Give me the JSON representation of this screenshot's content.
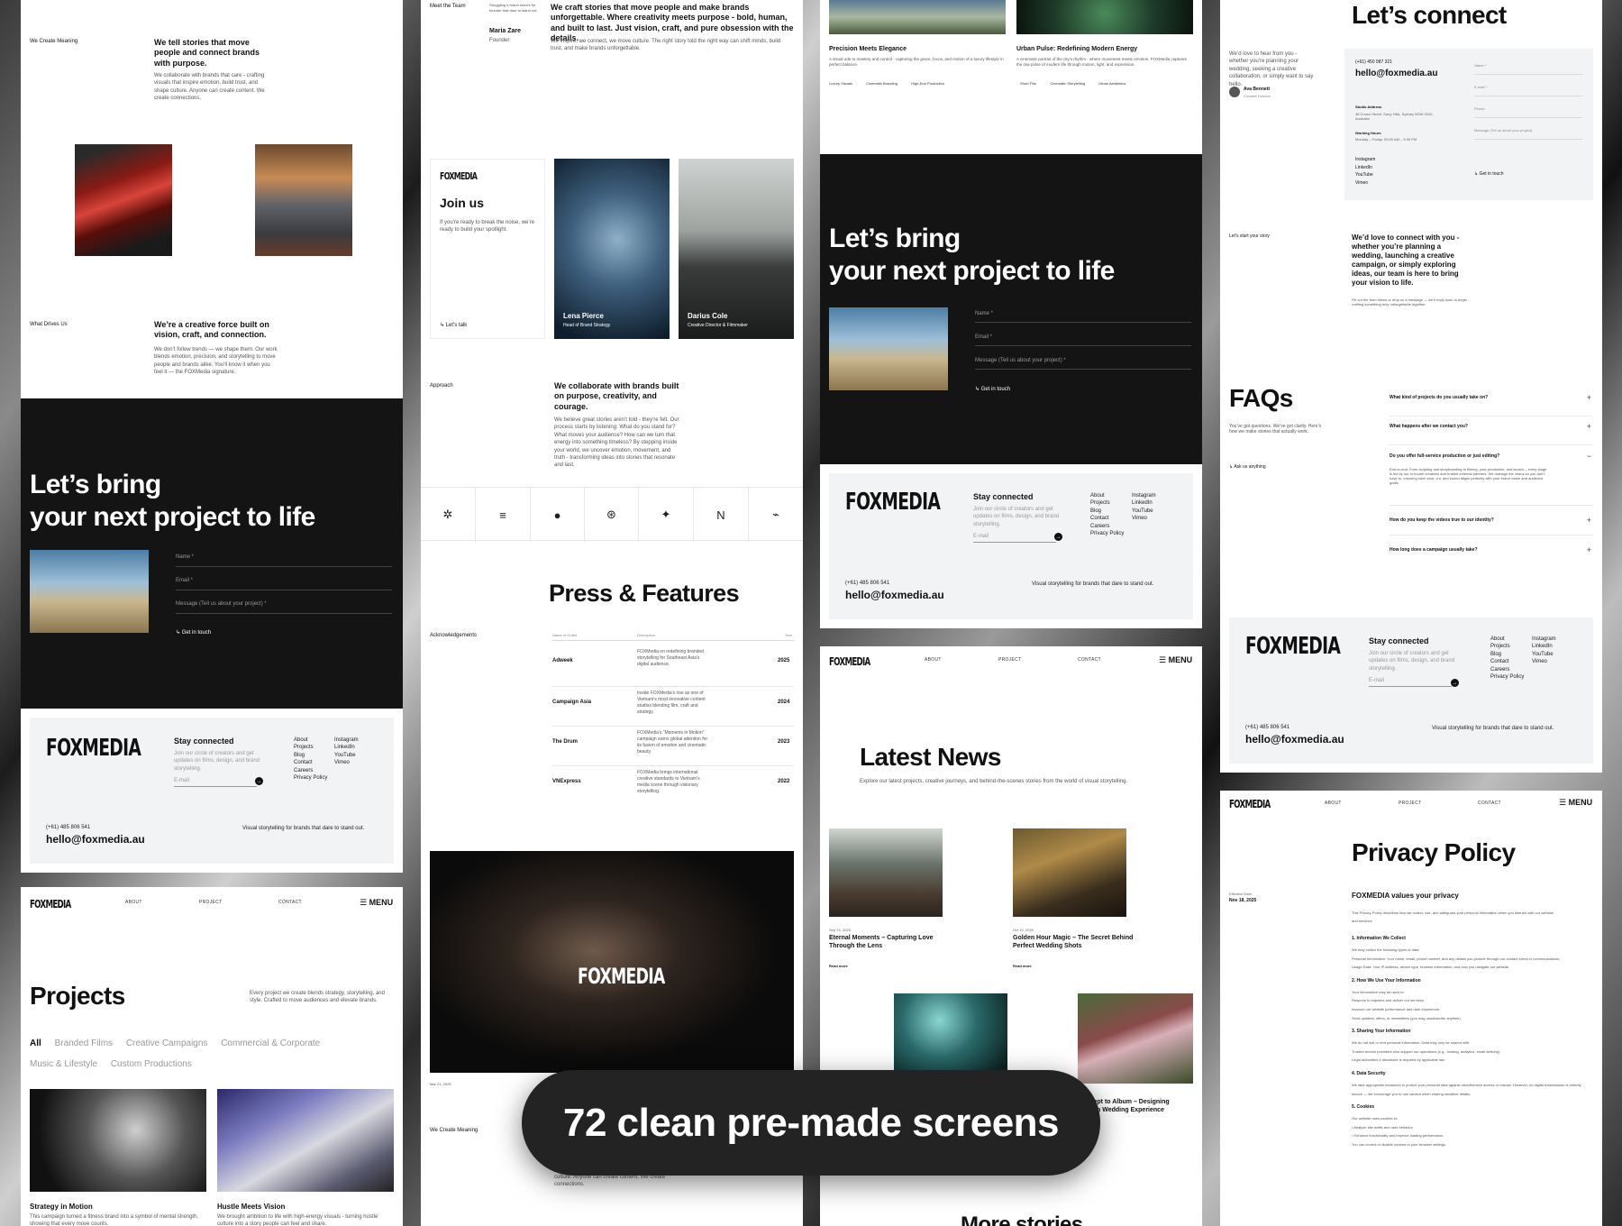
{
  "banner": {
    "text": "72 clean pre-made screens"
  },
  "brand": {
    "logo": "FOXMEDIA",
    "email": "hello@foxmedia.au",
    "phone": "(+61) 485 806 541",
    "phone2": "(+61) 450 987 321",
    "tagline": "Visual storytelling for brands that dare to stand out.",
    "stay": "Stay connected",
    "stay_desc": "Join our circle of creators and get updates on films, design, and brand storytelling.",
    "email_ph": "E-mail",
    "footer_links": [
      "About",
      "Projects",
      "Blog",
      "Contact",
      "Careers",
      "Privacy Policy"
    ],
    "social": [
      "Instagram",
      "LinkedIn",
      "YouTube",
      "Vimeo"
    ]
  },
  "cta": {
    "title1": "Let’s bring",
    "title2": "your next project to life",
    "name": "Name *",
    "email": "Email *",
    "message": "Message (Tell us about your project) *",
    "button": "Get in touch"
  },
  "col1": {
    "create_label": "We Create Meaning",
    "create_title": "We tell stories that move people and connect brands with purpose.",
    "create_body": "We collaborate with brands that care - crafting visuals that inspire emotion, build trust, and shape culture. Anyone can create content. We create connections.",
    "drives_label": "What Drives Us",
    "drives_title": "We’re a creative force built on vision, craft, and connection.",
    "drives_body": "We don’t follow trends — we shape them. Our work blends emotion, precision, and storytelling to move people and brands alike. You’ll know it when you feel it — the FOXMedia signature.",
    "nav": [
      "ABOUT",
      "PROJECT",
      "CONTACT"
    ],
    "menu": "MENU",
    "projects_title": "Projects",
    "projects_desc": "Every project we create blends strategy, storytelling, and style. Crafted to move audiences and elevate brands.",
    "filters": [
      "All",
      "Branded Films",
      "Creative Campaigns",
      "Commercial & Corporate",
      "Music & Lifestyle",
      "Custom Productions"
    ],
    "proj1": "Strategy in Motion",
    "proj1_desc": "This campaign turned a fitness brand into a symbol of mental strength, showing that every move counts.",
    "proj2": "Hustle Meets Vision",
    "proj2_desc": "We brought ambition to life with high-energy visuals - turning hustle culture into a story people can feel and share."
  },
  "col2": {
    "team_label": "Meet the Team",
    "team_blurb": "Struggling a brand stories for founder that dare to stand out.",
    "team_member": "Maria Zare",
    "team_role": "Founder",
    "intro_title": "We craft stories that move people and make brands unforgettable. Where creativity meets purpose - bold, human, and built to last. Just vision, craft, and pure obsession with the details.",
    "intro_body": "We inspire, we connect, we move culture. The right story told the right way can shift minds, build trust, and make brands unforgettable.",
    "join_title": "Join us",
    "join_body": "If you’re ready to break the noise, we’re ready to build your spotlight.",
    "join_btn": "Let’s talk",
    "person1": "Lena Pierce",
    "person1_role": "Head of Brand Strategy",
    "person2": "Darius Cole",
    "person2_role": "Creative Director & Filmmaker",
    "approach_label": "Approach",
    "approach_title": "We collaborate with brands built on purpose, creativity, and courage.",
    "approach_body": "We believe great stories aren’t told - they’re felt. Our process starts by listening: What do you stand for? What moves your audience? How can we turn that energy into something timeless? By stepping inside your world, we uncover emotion, movement, and truth - transforming ideas into stories that resonate and last.",
    "logos": [
      "✲",
      "≡",
      "●",
      "⊛",
      "✦",
      "N",
      "⌁"
    ],
    "press_title": "Press & Features",
    "ack": "Acknowledgements",
    "press_headers": [
      "Name of Outlet",
      "Description",
      "Year"
    ],
    "press_rows": [
      {
        "outlet": "Adweek",
        "desc": "FOXMedia on redefining branded storytelling for Southeast Asia’s digital audience.",
        "year": "2025"
      },
      {
        "outlet": "Campaign Asia",
        "desc": "Inside FOXMedia’s rise as one of Vietnam’s most innovative content studios blending film, craft and strategy.",
        "year": "2024"
      },
      {
        "outlet": "The Drum",
        "desc": "FOXMedia’s “Moments in Motion” campaign earns global attention for its fusion of emotion and cinematic beauty.",
        "year": "2023"
      },
      {
        "outlet": "VNExpress",
        "desc": "FOXMedia brings international creative standards to Vietnam’s media scene through visionary storytelling.",
        "year": "2022"
      }
    ],
    "hero_logo": "FOXMEDIA",
    "date": "Mar 21, 2025",
    "create_label": "We Create Meaning",
    "bottom_body": "culture. Anyone can create content. We create connections."
  },
  "col3": {
    "card1": "Precision Meets Elegance",
    "card1_desc": "A visual ode to mastery and control - capturing the grace, focus, and motion of a luxury lifestyle in perfect balance.",
    "card1_tags": [
      "Luxury Visuals",
      "Cinematic Branding",
      "High-End Production"
    ],
    "card2": "Urban Pulse: Redefining Modern Energy",
    "card2_desc": "A cinematic portrait of the city’s rhythm - where movement meets emotion. FOXMedia captures the raw pulse of modern life through motion, light, and expression.",
    "card2_tags": [
      "Short Film",
      "Cinematic Storytelling",
      "Urban Aesthetics"
    ],
    "nav": [
      "ABOUT",
      "PROJECT",
      "CONTACT"
    ],
    "menu": "MENU",
    "news_title": "Latest News",
    "news_desc": "Explore our latest projects, creative journeys, and behind-the-scenes stories from the world of visual storytelling.",
    "news1_date": "Sep 24, 2025",
    "news1": "Eternal Moments – Capturing Love Through the Lens",
    "news2_date": "Oct 10, 2025",
    "news2": "Golden Hour Magic – The Secret Behind Perfect Wedding Shots",
    "read_more": "Read more",
    "news4": "Concept to Album – Designing Modern Wedding Experience",
    "more": "More stories"
  },
  "col4": {
    "connect_title": "Let’s connect",
    "connect_body": "We’d love to hear from you - whether you’re planning your wedding, seeking a creative collaboration, or simply want to say hello.",
    "person": "Ava Bennett",
    "person_role": "Creative Director",
    "studio_label": "Studio Address",
    "studio": "48 Crown Street, Surry Hills, Sydney NSW 2010, Australia",
    "hours_label": "Working Hours",
    "hours": "Monday – Friday: 09:00 AM – 5:30 PM",
    "form": [
      "Name *",
      "E-mail *",
      "Phone",
      "Message (Tell us about your project)"
    ],
    "btn": "Get in touch",
    "story_label": "Let’s start your story",
    "story_title": "We’d love to connect with you - whether you’re planning a wedding, launching a creative campaign, or simply exploring ideas, our team is here to bring your vision to life.",
    "story_body": "Fill out the form below or drop us a message — we’ll reply soon to begin crafting something truly unforgettable together.",
    "faq_title": "FAQs",
    "faq_body": "You’ve got questions. We’ve got clarity. Here’s how we make stories that actually work.",
    "faq_link": "Ask us anything",
    "faqs": [
      "What kind of projects do you usually take on?",
      "What happens after we contact you?",
      "Do you offer full-service production or just editing?",
      "How do you keep the videos true to our identity?",
      "How long does a campaign usually take?"
    ],
    "faq_answer": "End-to-end. From scripting and storyboarding to filming, post-production, and launch – every stage is led by our in-house creatives and trusted external partners. We manage the chaos so you don’t have to, ensuring each shot, cut, and sound aligns perfectly with your brand vision and audience goals.",
    "nav": [
      "ABOUT",
      "PROJECT",
      "CONTACT"
    ],
    "menu": "MENU",
    "privacy_title": "Privacy Policy",
    "eff_label": "Effective Date:",
    "eff_date": "Nov 18, 2025",
    "privacy_sub": "FOXMEDIA values your privacy",
    "privacy_intro": "This Privacy Policy describes how we collect, use, and safeguard your personal information when you interact with our website and services.",
    "sections": [
      {
        "h": "1. Information We Collect",
        "p": [
          "We may collect the following types of data:",
          "Personal Information: Your name, email, phone number, and any details you provide through our contact forms or communications.",
          "Usage Data: Your IP address, device type, browser information, and how you navigate our website."
        ]
      },
      {
        "h": "2. How We Use Your Information",
        "p": [
          "Your information may be used to:",
          "Respond to inquiries and deliver our services.",
          "Improve our website performance and user experience.",
          "Send updates, offers, or newsletters (you may unsubscribe anytime)."
        ]
      },
      {
        "h": "3. Sharing Your Information",
        "p": [
          "We do not sell or rent personal information. Data may only be shared with:",
          "Trusted service providers who support our operations (e.g., hosting, analytics, email delivery).",
          "Legal authorities if disclosure is required by applicable law."
        ]
      },
      {
        "h": "4. Data Security",
        "p": [
          "We take appropriate measures to protect your personal data against unauthorized access or misuse. However, no digital transmission is entirely secure — we encourage you to use caution when sharing sensitive details."
        ]
      },
      {
        "h": "5. Cookies",
        "p": [
          "Our website uses cookies to:",
          "• Analyze site traffic and user behavior.",
          "• Enhance functionality and improve loading performance.",
          "You can control or disable cookies in your browser settings."
        ]
      }
    ]
  },
  "colors": {
    "dark": "#141414",
    "footer": "#f2f3f4",
    "accent": "#111111"
  }
}
